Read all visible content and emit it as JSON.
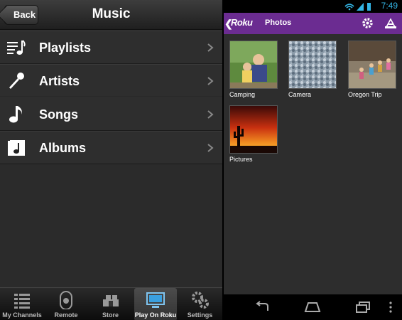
{
  "left": {
    "nav": {
      "back_label": "Back",
      "title": "Music"
    },
    "menu": [
      {
        "label": "Playlists",
        "icon": "playlist-icon"
      },
      {
        "label": "Artists",
        "icon": "microphone-icon"
      },
      {
        "label": "Songs",
        "icon": "music-note-icon"
      },
      {
        "label": "Albums",
        "icon": "album-icon"
      }
    ],
    "tabs": [
      {
        "label": "My Channels",
        "icon": "channels-icon",
        "active": false
      },
      {
        "label": "Remote",
        "icon": "remote-icon",
        "active": false
      },
      {
        "label": "Store",
        "icon": "store-icon",
        "active": false
      },
      {
        "label": "Play On Roku",
        "icon": "play-on-roku-icon",
        "active": true
      },
      {
        "label": "Settings",
        "icon": "settings-gears-icon",
        "active": false
      }
    ]
  },
  "right": {
    "status": {
      "time": "7:49"
    },
    "actionbar": {
      "back": "❮",
      "brand": "Roku",
      "title": "Photos",
      "color": "#6b2c91"
    },
    "albums": [
      {
        "caption": "Camping"
      },
      {
        "caption": "Camera"
      },
      {
        "caption": "Oregon Trip"
      },
      {
        "caption": "Pictures"
      }
    ]
  }
}
